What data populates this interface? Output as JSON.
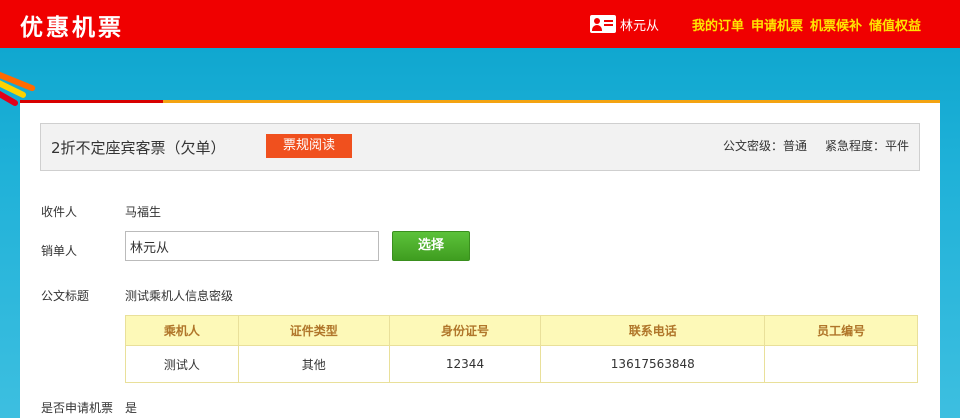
{
  "header": {
    "logo": "优惠机票",
    "user_name": "林元从",
    "nav": [
      "我的订单",
      "申请机票",
      "机票候补",
      "储值权益"
    ]
  },
  "doc": {
    "title": "2折不定座宾客票（欠单）",
    "rules_button": "票规阅读",
    "secrecy": "公文密级：普通",
    "urgency": "紧急程度：平件"
  },
  "form": {
    "recipient_label": "收件人",
    "recipient_value": "马福生",
    "canceller_label": "销单人",
    "canceller_input": "林元从",
    "select_button": "选择",
    "subject_label": "公文标题",
    "subject_value": "测试乘机人信息密级",
    "apply_label": "是否申请机票",
    "apply_value": "是"
  },
  "table": {
    "headers": [
      "乘机人",
      "证件类型",
      "身份证号",
      "联系电话",
      "员工编号"
    ],
    "rows": [
      [
        "测试人",
        "其他",
        "12344",
        "13617563848",
        ""
      ]
    ]
  },
  "colors": {
    "topbar": "#f00000",
    "nav_link": "#ffe400",
    "rules_button": "#f0501e",
    "select_button": "#4cae2c",
    "table_header_bg": "#fdf9b8",
    "table_header_text": "#b0762a"
  }
}
